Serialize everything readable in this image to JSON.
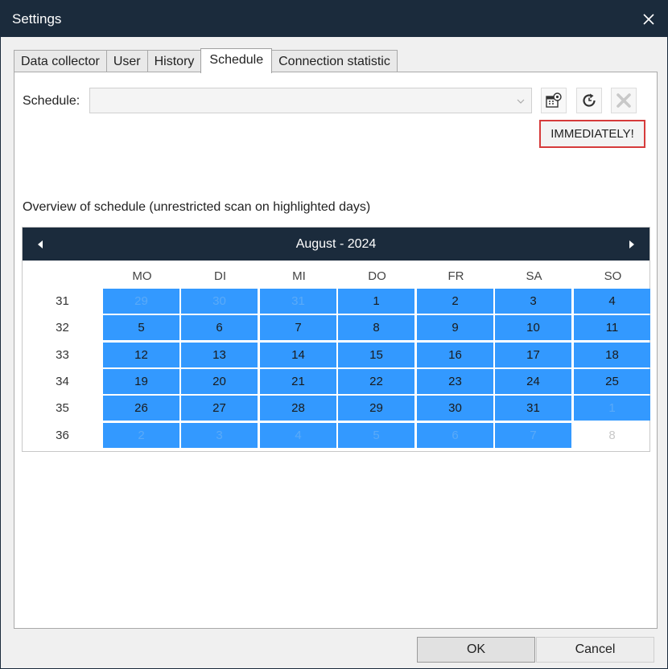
{
  "window": {
    "title": "Settings"
  },
  "tabs": [
    {
      "label": "Data collector",
      "active": false
    },
    {
      "label": "User",
      "active": false
    },
    {
      "label": "History",
      "active": false
    },
    {
      "label": "Schedule",
      "active": true
    },
    {
      "label": "Connection statistic",
      "active": false
    }
  ],
  "schedule": {
    "label": "Schedule:",
    "value": "",
    "buttons": [
      "schedule-settings-icon",
      "refresh-schedule-icon",
      "delete-schedule-icon"
    ],
    "badge": "IMMEDIATELY!"
  },
  "overview": {
    "label": "Overview of schedule (unrestricted scan on highlighted days)"
  },
  "calendar": {
    "title": "August - 2024",
    "weekdays": [
      "MO",
      "DI",
      "MI",
      "DO",
      "FR",
      "SA",
      "SO"
    ],
    "weeks": [
      {
        "number": "31",
        "days": [
          "29",
          "30",
          "31",
          "1",
          "2",
          "3",
          "4"
        ]
      },
      {
        "number": "32",
        "days": [
          "5",
          "6",
          "7",
          "8",
          "9",
          "10",
          "11"
        ]
      },
      {
        "number": "33",
        "days": [
          "12",
          "13",
          "14",
          "15",
          "16",
          "17",
          "18"
        ]
      },
      {
        "number": "34",
        "days": [
          "19",
          "20",
          "21",
          "22",
          "23",
          "24",
          "25"
        ]
      },
      {
        "number": "35",
        "days": [
          "26",
          "27",
          "28",
          "29",
          "30",
          "31",
          "1"
        ]
      },
      {
        "number": "36",
        "days": [
          "2",
          "3",
          "4",
          "5",
          "6",
          "7",
          "8"
        ]
      }
    ],
    "highlight_color": "#3399ff",
    "header_color": "#1b2b3c"
  },
  "footer": {
    "ok_label": "OK",
    "cancel_label": "Cancel"
  }
}
